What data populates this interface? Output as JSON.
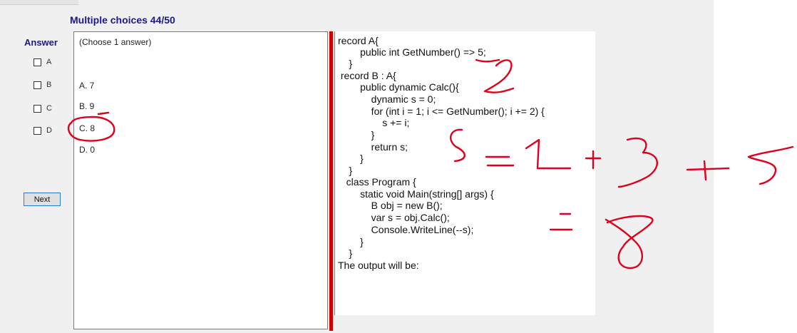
{
  "header": {
    "title": "Multiple choices 44/50"
  },
  "answer": {
    "label": "Answer",
    "options": [
      {
        "letter": "A"
      },
      {
        "letter": "B"
      },
      {
        "letter": "C"
      },
      {
        "letter": "D"
      }
    ],
    "next_label": "Next"
  },
  "question": {
    "instruction": "(Choose 1 answer)",
    "choices": [
      "A. 7",
      "B. 9",
      "C. 8",
      "D. 0"
    ]
  },
  "code": {
    "lines": [
      "record A{",
      "        public int GetNumber() => 5;",
      "    }",
      " record B : A{",
      "        public dynamic Calc(){",
      "            dynamic s = 0;",
      "            for (int i = 1; i <= GetNumber(); i += 2) {",
      "                s += i;",
      "            }",
      "            return s;",
      "        }",
      "    }",
      "   class Program {",
      "        static void Main(string[] args) {",
      "            B obj = new B();",
      "            var s = obj.Calc();",
      "            Console.WriteLine(--s);",
      "        }",
      "    }",
      "The output will be:"
    ]
  },
  "colors": {
    "ink": "#e0001b",
    "title": "#1a1a8c",
    "divider": "#d00000"
  }
}
